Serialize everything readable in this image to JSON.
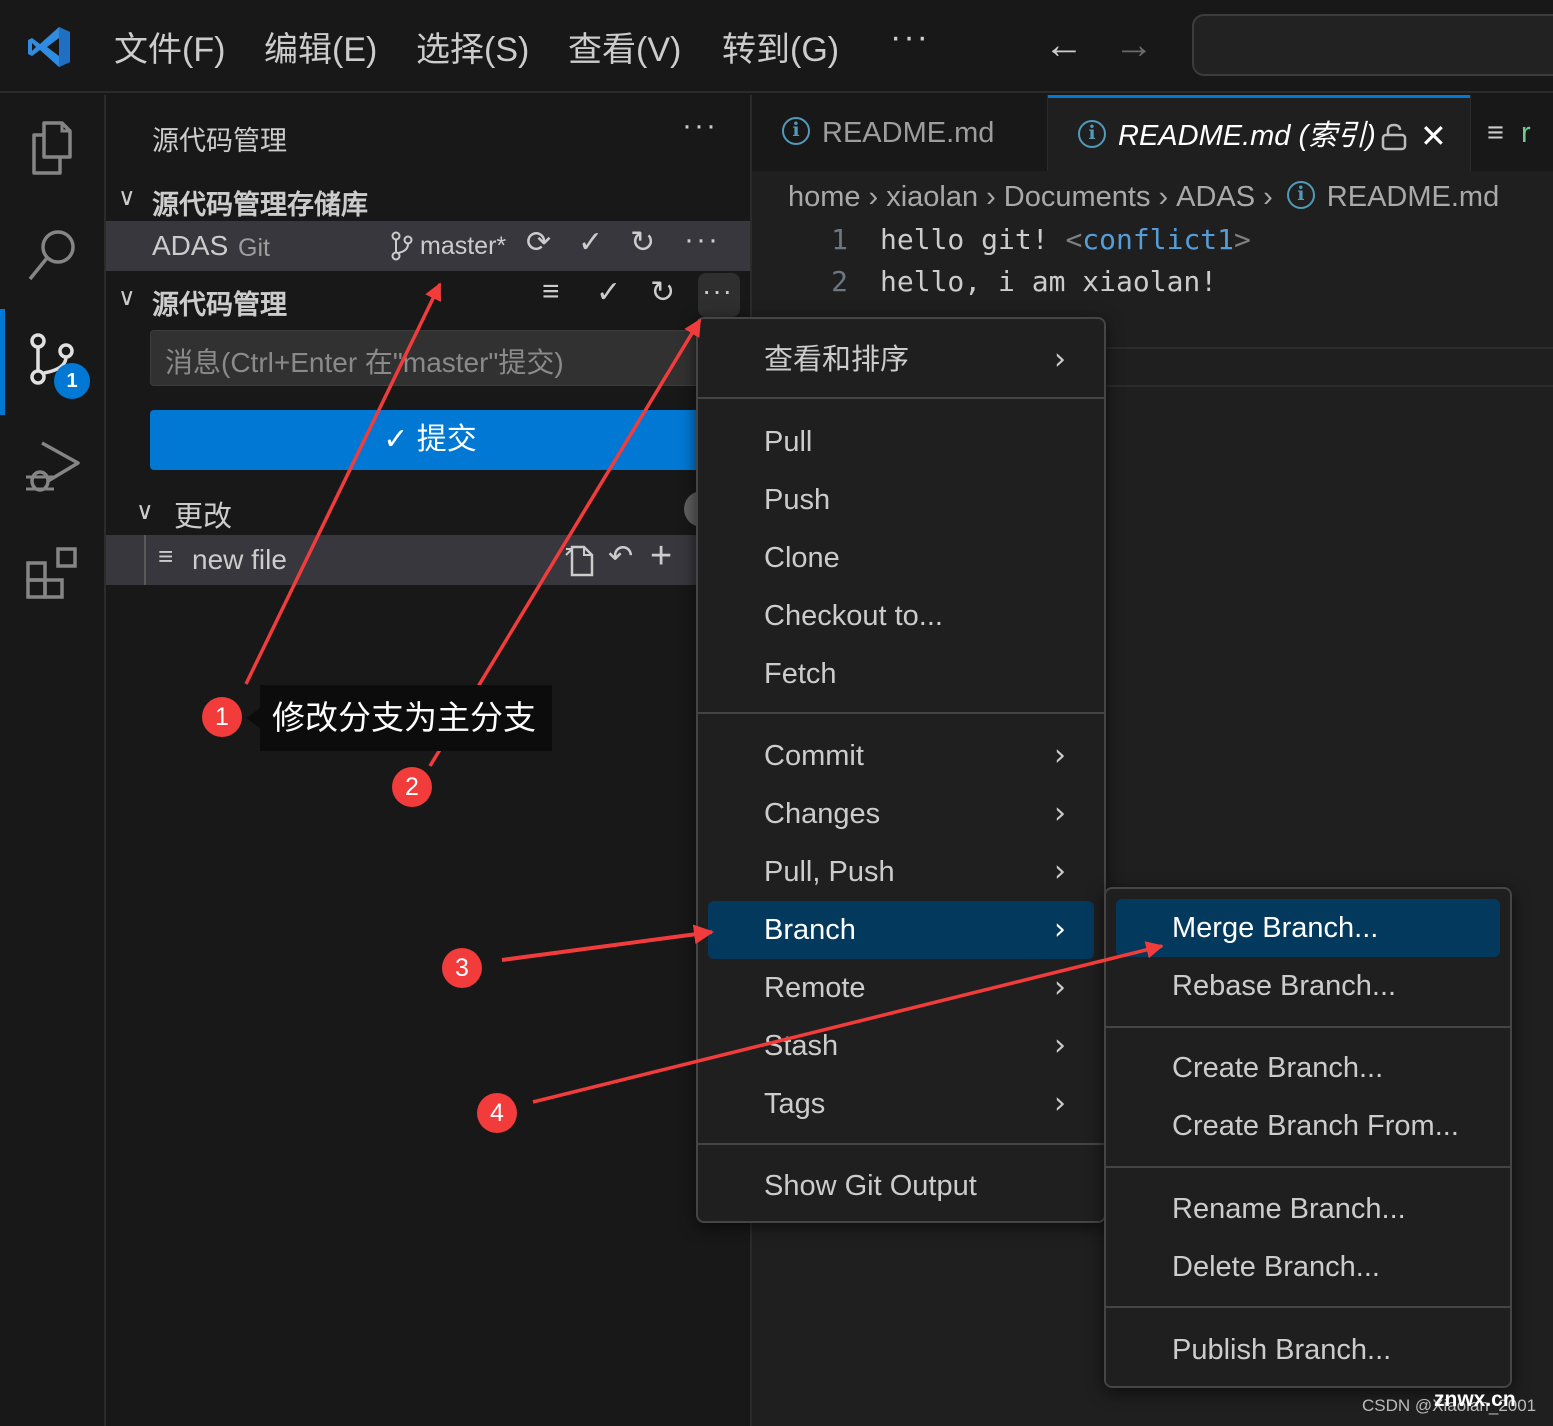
{
  "titlebar": {
    "menus": [
      "文件(F)",
      "编辑(E)",
      "选择(S)",
      "查看(V)",
      "转到(G)",
      "···"
    ],
    "nav_back": "←",
    "nav_forward": "→",
    "command_center_text": ""
  },
  "activitybar": {
    "items": [
      {
        "name": "explorer",
        "icon": "files-icon"
      },
      {
        "name": "search",
        "icon": "search-icon"
      },
      {
        "name": "source-control",
        "icon": "source-control-icon",
        "badge": "1",
        "active": true
      },
      {
        "name": "run-and-debug",
        "icon": "debug-icon"
      },
      {
        "name": "extensions",
        "icon": "extensions-icon"
      }
    ]
  },
  "sidebar": {
    "title": "源代码管理",
    "title_more": "···",
    "repositories_section": "源代码管理存储库",
    "repo": {
      "name": "ADAS",
      "type": "Git",
      "branch": "master*",
      "actions_more": "···"
    },
    "scm_section": "源代码管理",
    "scm_more": "···",
    "commit_placeholder": "消息(Ctrl+Enter 在\"master\"提交)",
    "commit_button": "✓ 提交",
    "changes_section": "更改",
    "changes": [
      {
        "name": "new file"
      }
    ]
  },
  "editor": {
    "tabs": [
      {
        "label": "README.md",
        "active": false
      },
      {
        "label": "README.md (索引)",
        "active": true,
        "locked": true
      },
      {
        "label": "r",
        "active": false
      }
    ],
    "breadcrumb": [
      "home",
      "xiaolan",
      "Documents",
      "ADAS",
      "README.md"
    ],
    "lines": [
      {
        "number": "1",
        "text": "hello git! ",
        "tag_open": "<",
        "tag_name": "conflict1",
        "tag_close": ">"
      },
      {
        "number": "2",
        "text": "hello, i am xiaolan!"
      }
    ]
  },
  "context_menu": {
    "groups": [
      [
        {
          "label": "查看和排序",
          "submenu": true
        }
      ],
      [
        {
          "label": "Pull"
        },
        {
          "label": "Push"
        },
        {
          "label": "Clone"
        },
        {
          "label": "Checkout to..."
        },
        {
          "label": "Fetch"
        }
      ],
      [
        {
          "label": "Commit",
          "submenu": true
        },
        {
          "label": "Changes",
          "submenu": true
        },
        {
          "label": "Pull, Push",
          "submenu": true
        },
        {
          "label": "Branch",
          "submenu": true,
          "active": true
        },
        {
          "label": "Remote",
          "submenu": true
        },
        {
          "label": "Stash",
          "submenu": true
        },
        {
          "label": "Tags",
          "submenu": true
        }
      ],
      [
        {
          "label": "Show Git Output"
        }
      ]
    ]
  },
  "branch_submenu": {
    "groups": [
      [
        {
          "label": "Merge Branch...",
          "active": true
        },
        {
          "label": "Rebase Branch..."
        }
      ],
      [
        {
          "label": "Create Branch..."
        },
        {
          "label": "Create Branch From..."
        }
      ],
      [
        {
          "label": "Rename Branch..."
        },
        {
          "label": "Delete Branch..."
        }
      ],
      [
        {
          "label": "Publish Branch..."
        }
      ]
    ]
  },
  "annotations": {
    "callout": "修改分支为主分支",
    "steps": [
      "1",
      "2",
      "3",
      "4"
    ],
    "arrow_color": "#f23c3c"
  },
  "watermark": {
    "credit": "CSDN @Xiaolan_2001",
    "site": "znwx.cn"
  },
  "colors": {
    "accent": "#0078d4",
    "menu_active": "#04395e",
    "annotation_red": "#f23c3c"
  }
}
